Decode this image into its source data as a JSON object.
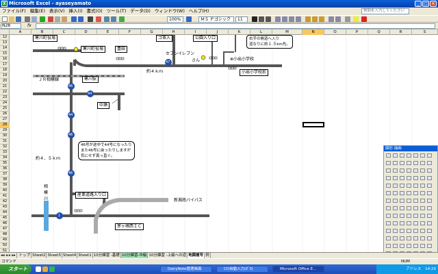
{
  "window": {
    "title": "Microsoft Excel - ayaseyamato"
  },
  "menu": {
    "items": [
      "ファイル(F)",
      "編集(E)",
      "表示(V)",
      "挿入(I)",
      "書式(O)",
      "ツール(T)",
      "データ(D)",
      "ウィンドウ(W)",
      "ヘルプ(H)"
    ],
    "help_placeholder": "質問を入力してください"
  },
  "toolbar": {
    "zoom": "100%",
    "font": "ＭＳ Ｐゴシック",
    "size": "11"
  },
  "formula": {
    "cell": "N28",
    "fx": "fx"
  },
  "columns": [
    "A",
    "B",
    "C",
    "D",
    "E",
    "F",
    "G",
    "H",
    "I",
    "J",
    "K",
    "L",
    "M",
    "N",
    "O",
    "P",
    "Q",
    "R",
    "S"
  ],
  "rows": [
    "12",
    "13",
    "14",
    "15",
    "16",
    "17",
    "18",
    "19",
    "20",
    "21",
    "22",
    "23",
    "24",
    "25",
    "26",
    "27",
    "28",
    "29",
    "30",
    "31",
    "32",
    "33",
    "34",
    "35",
    "36",
    "37",
    "38",
    "39",
    "40",
    "41",
    "42",
    "43",
    "44",
    "45",
    "46",
    "47",
    "48",
    "49",
    "50",
    "51"
  ],
  "map": {
    "sagamigawa_office": "寒川町役場",
    "sagamigawa_office2": "寒川町役場",
    "toyota": "豊田",
    "seven": "セブンイレブン",
    "san": "さん",
    "park_entrance": "公園入り口",
    "go_store": "ゴ茶入",
    "right_note1": "右手の側道へ入り",
    "right_note2": "道なりに約１.５km先。",
    "koide_school": "小出小学校",
    "koide_school2": "小出小学校前",
    "about4km": "約４ｋｍ",
    "jr_line": "ＪＲ相模線",
    "samukawa_sta": "寒川駅",
    "nakase": "中瀬",
    "r47": "47",
    "r46a": "46",
    "r44a": "44",
    "r44b": "44",
    "r46b": "46",
    "r46c": "46",
    "r1": "1",
    "about45km": "約４．５ｋｍ",
    "note1": "46号が途中で44号になったり",
    "note2": "また46号に戻ったりしますが",
    "note3": "気にせず真っ直ぐ。",
    "sagami1": "相",
    "sagami2": "模",
    "sagami3": "川",
    "industrial": "産業道路入り口",
    "bypass": "新湘南バイパス",
    "chigasaki": "茅ヶ崎西ＩＣ"
  },
  "palette": {
    "title": "図形 描画"
  },
  "tabs": [
    "トップ",
    "Sheet2",
    "Sheet3",
    "Sheet4",
    "Sheet1",
    "10分練習 -基礎",
    "10分練習-中級",
    "10分練習 -上級への道",
    "地図複写",
    "例"
  ],
  "status": {
    "left": "コマンド",
    "num": "NUM"
  },
  "taskbar": {
    "start": "スタート",
    "tasks": [
      "DairyNote管理画面",
      "CD自動入力(ｾﾞﾛ)",
      "Microsoft Office E..."
    ],
    "tray": "アドレス",
    "time": "14:29"
  }
}
